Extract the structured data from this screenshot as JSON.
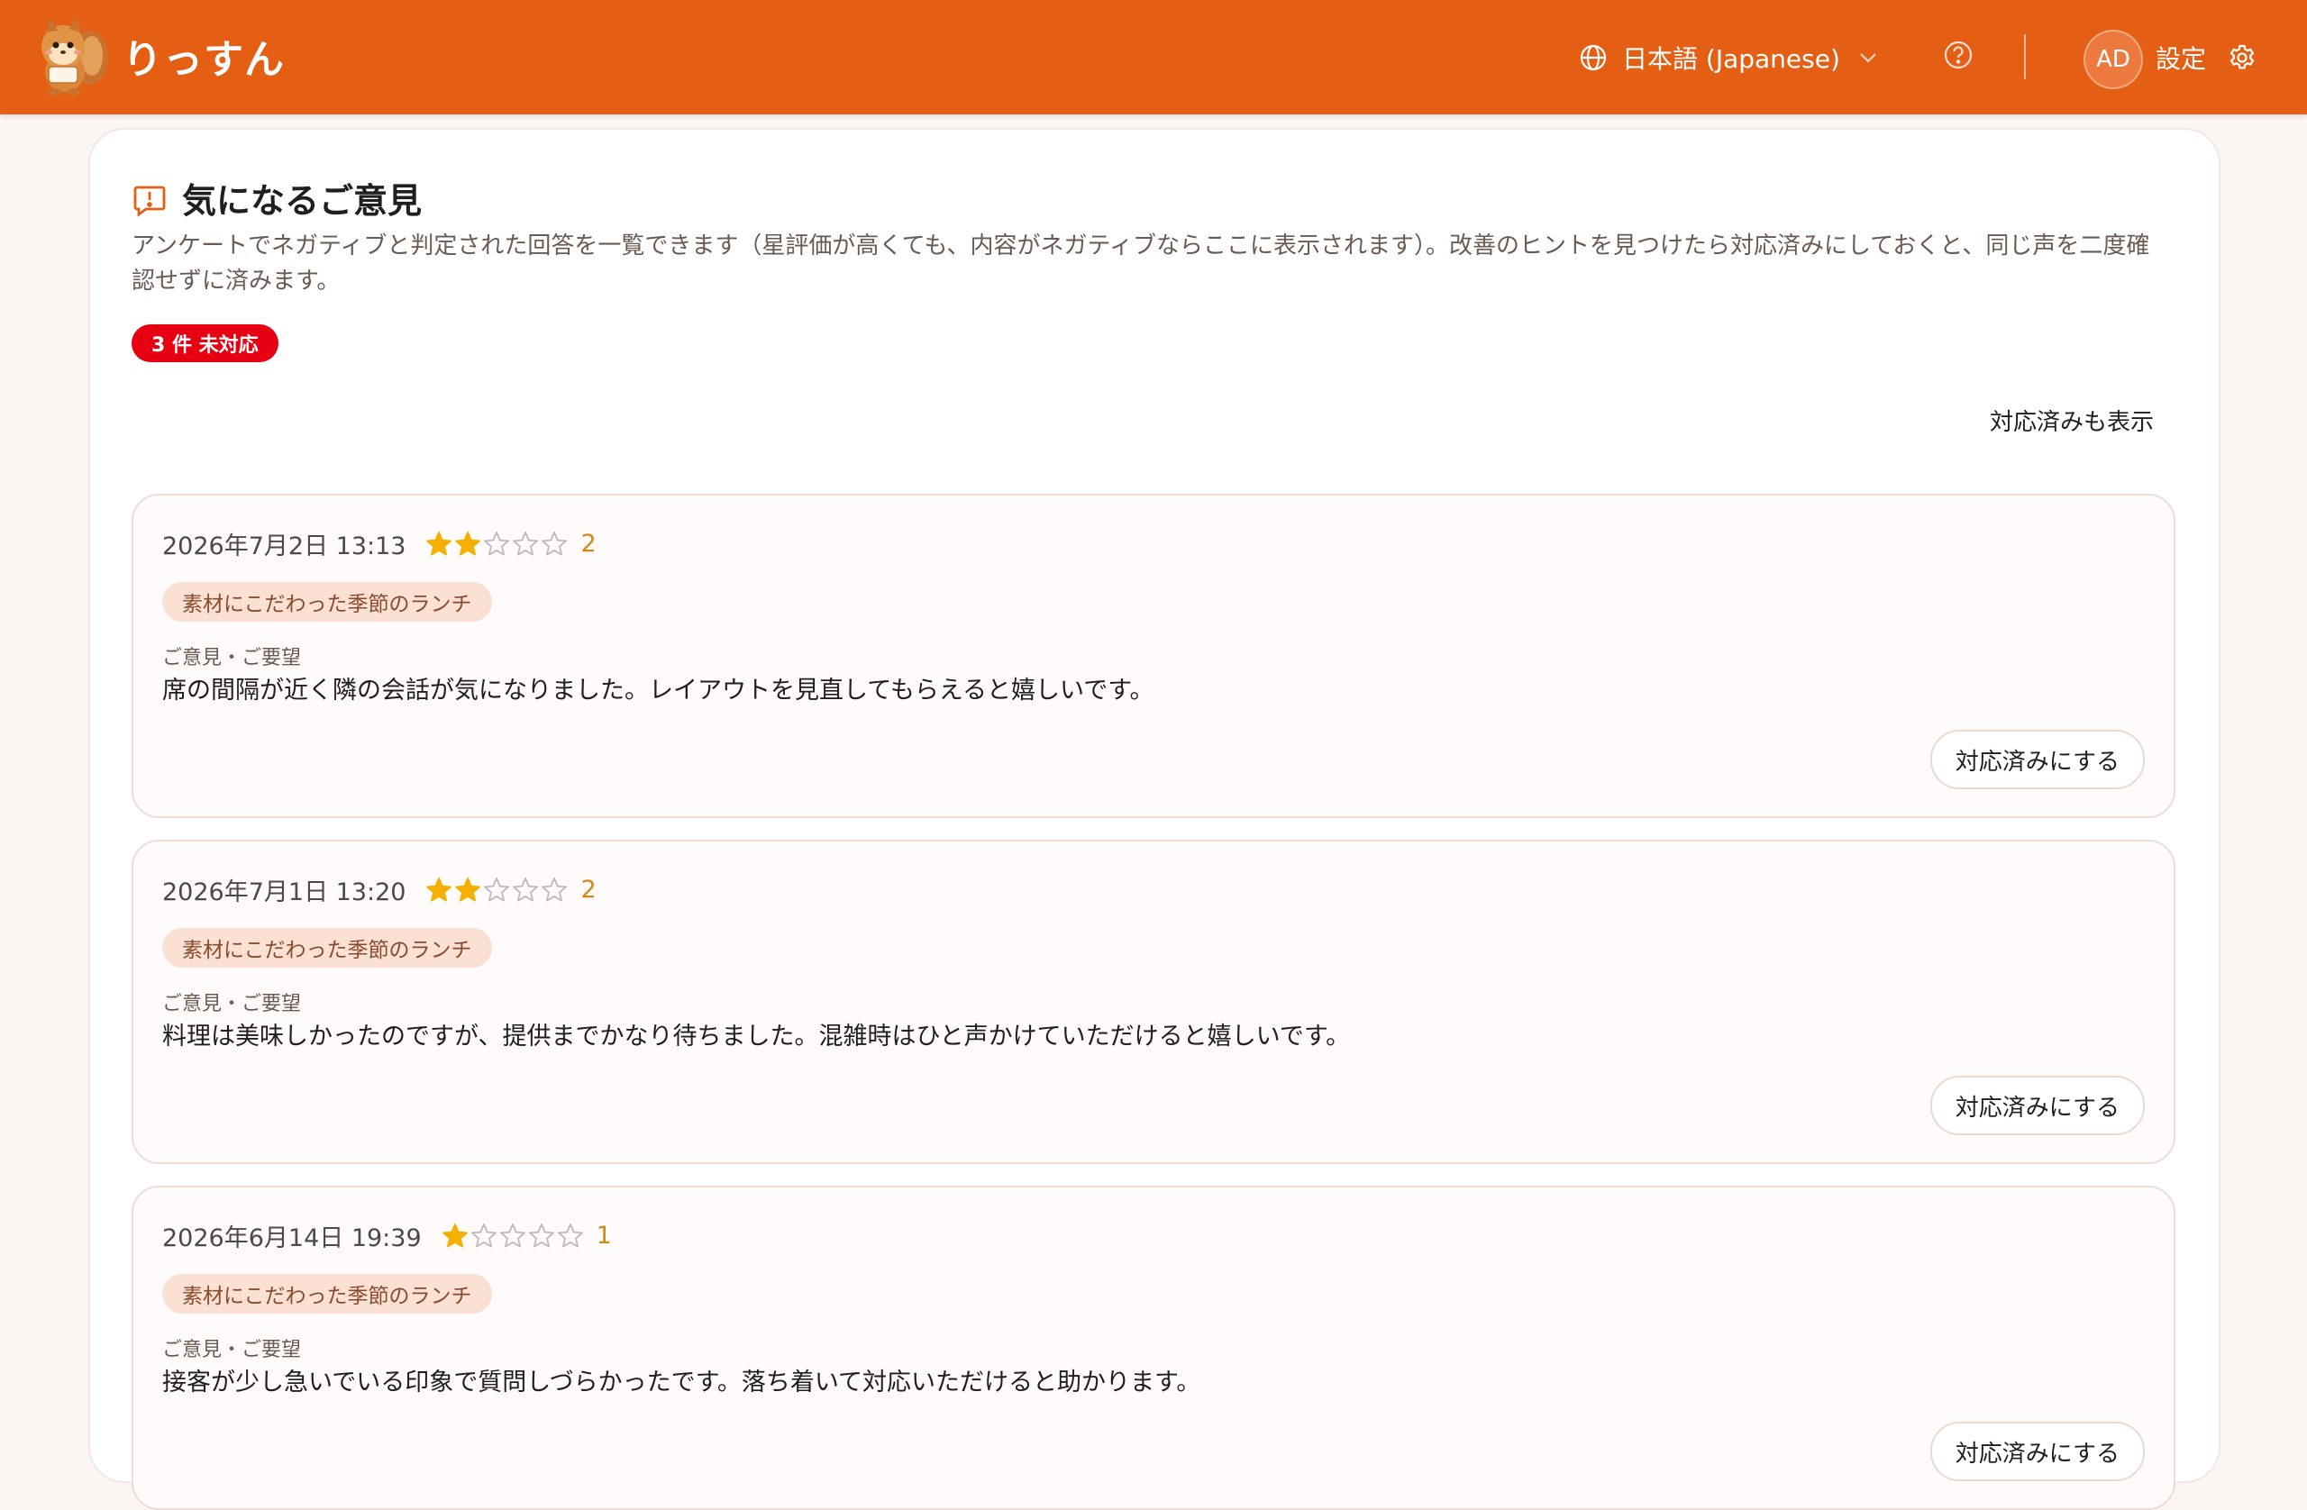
{
  "header": {
    "brand": "りっすん",
    "language_label": "日本語 (Japanese)",
    "avatar_initials": "AD",
    "settings_label": "設定",
    "brand_color": "#e45f14"
  },
  "page": {
    "title": "気になるご意見",
    "description": "アンケートでネガティブと判定された回答を一覧できます（星評価が高くても、内容がネガティブならここに表示されます）。改善のヒントを見つけたら対応済みにしておくと、同じ声を二度確認せずに済みます。",
    "badge": "3 件 未対応",
    "show_resolved_label": "対応済みも表示"
  },
  "cards": [
    {
      "date": "2026年7月2日 13:13",
      "stars": 2,
      "rating": "2",
      "tag": "素材にこだわった季節のランチ",
      "field_label": "ご意見・ご要望",
      "comment": "席の間隔が近く隣の会話が気になりました。レイアウトを見直してもらえると嬉しいです。",
      "button": "対応済みにする"
    },
    {
      "date": "2026年7月1日 13:20",
      "stars": 2,
      "rating": "2",
      "tag": "素材にこだわった季節のランチ",
      "field_label": "ご意見・ご要望",
      "comment": "料理は美味しかったのですが、提供までかなり待ちました。混雑時はひと声かけていただけると嬉しいです。",
      "button": "対応済みにする"
    },
    {
      "date": "2026年6月14日 19:39",
      "stars": 1,
      "rating": "1",
      "tag": "素材にこだわった季節のランチ",
      "field_label": "ご意見・ご要望",
      "comment": "接客が少し急いでいる印象で質問しづらかったです。落ち着いて対応いただけると助かります。",
      "button": "対応済みにする"
    }
  ]
}
